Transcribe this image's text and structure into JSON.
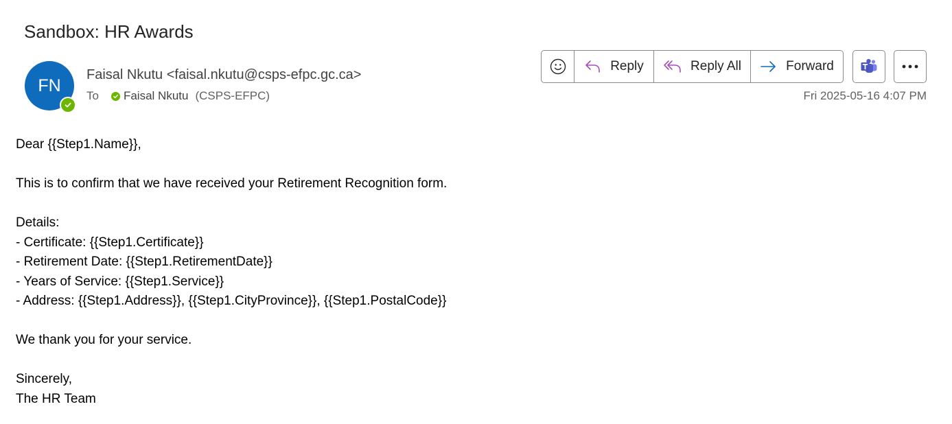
{
  "email": {
    "subject": "Sandbox: HR Awards",
    "avatar_initials": "FN",
    "sender": "Faisal Nkutu <faisal.nkutu@csps-efpc.gc.ca>",
    "to_label": "To",
    "recipient_name": "Faisal Nkutu",
    "recipient_org": "(CSPS-EFPC)",
    "timestamp": "Fri 2025-05-16 4:07 PM"
  },
  "toolbar": {
    "emoji_icon": "smiley-icon",
    "reply_label": "Reply",
    "reply_all_label": "Reply All",
    "forward_label": "Forward",
    "teams_icon": "teams-icon",
    "more_icon": "more-options-icon"
  },
  "colors": {
    "avatar_bg": "#0f6cbd",
    "presence_green": "#6bb700",
    "reply_icon": "#a64fbf",
    "forward_icon": "#0f6cbd",
    "teams_purple": "#5059c9"
  },
  "body": {
    "greeting": "Dear {{Step1.Name}},",
    "confirmation": "This is to confirm that we have received your Retirement Recognition form.",
    "details_heading": "Details:",
    "details": [
      "- Certificate: {{Step1.Certificate}}",
      "- Retirement Date: {{Step1.RetirementDate}}",
      "- Years of Service: {{Step1.Service}}",
      "- Address: {{Step1.Address}}, {{Step1.CityProvince}}, {{Step1.PostalCode}}"
    ],
    "thanks": "We thank you for your service.",
    "closing": "Sincerely,",
    "signature": "The HR Team"
  }
}
